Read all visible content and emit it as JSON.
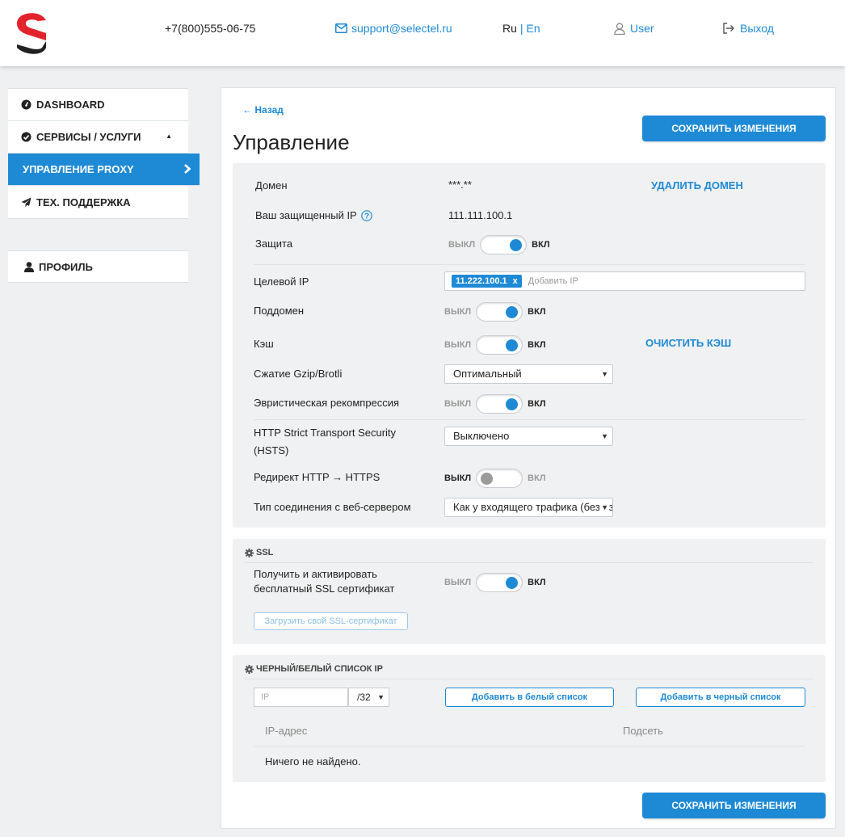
{
  "header": {
    "phone": "+7(800)555-06-75",
    "email": "support@selectel.ru",
    "lang_ru": "Ru",
    "lang_sep": "|",
    "lang_en": "En",
    "user": "User",
    "logout": "Выход"
  },
  "sidebar": {
    "dashboard": "DASHBOARD",
    "services": "СЕРВИСЫ / УСЛУГИ",
    "proxy": "УПРАВЛЕНИЕ PROXY",
    "support": "ТЕХ. ПОДДЕРЖКА",
    "profile": "ПРОФИЛЬ"
  },
  "main": {
    "back": "← Назад",
    "title": "Управление",
    "save": "СОХРАНИТЬ ИЗМЕНЕНИЯ",
    "domain_label": "Домен",
    "domain_value": "***.**",
    "delete_domain": "УДАЛИТЬ ДОМЕН",
    "protected_ip_label": "Ваш защищенный IP",
    "protected_ip_value": "111.111.100.1",
    "protection_label": "Защита",
    "target_ip_label": "Целевой IP",
    "target_ip_tag": "11.222.100.1",
    "target_ip_tag_close": "x",
    "target_ip_placeholder": "Добавить IP",
    "subdomain_label": "Поддомен",
    "cache_label": "Кэш",
    "clear_cache": "ОЧИСТИТЬ КЭШ",
    "gzip_label": "Сжатие Gzip/Brotli",
    "gzip_value": "Оптимальный",
    "heuristic_label": "Эвристическая рекомпрессия",
    "hsts_label_1": "HTTP Strict Transport Security",
    "hsts_label_2": "(HSTS)",
    "hsts_value": "Выключено",
    "redirect_label": "Редирект HTTP → HTTPS",
    "conn_type_label": "Тип соединения с веб-сервером",
    "conn_type_value": "Как у входящего трафика (без изменений)"
  },
  "toggle": {
    "off": "ВЫКЛ",
    "on": "ВКЛ"
  },
  "toggles_state": {
    "protection": true,
    "subdomain": true,
    "cache": true,
    "heuristic": true,
    "redirect": false,
    "ssl": true
  },
  "ssl": {
    "heading": "SSL",
    "label_1": "Получить и активировать",
    "label_2": "бесплатный SSL сертификат",
    "upload": "Загрузить свой SSL-сертификат"
  },
  "iplist": {
    "heading": "ЧЕРНЫЙ/БЕЛЫЙ СПИСОК IP",
    "ip_placeholder": "IP",
    "mask_value": "/32",
    "add_white": "Добавить в белый список",
    "add_black": "Добавить в черный список",
    "col_ip": "IP-адрес",
    "col_subnet": "Подсеть",
    "empty": "Ничего не найдено."
  },
  "colors": {
    "accent": "#1e8ad6",
    "logo_red": "#e3232c",
    "logo_dark": "#222222"
  }
}
